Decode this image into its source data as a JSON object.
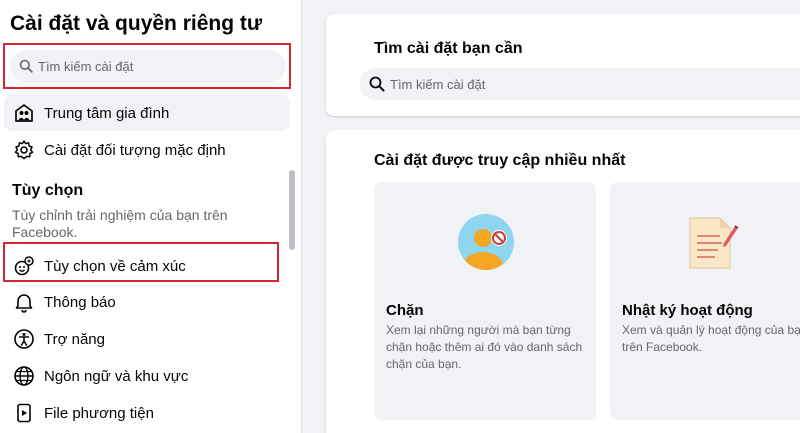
{
  "sidebar": {
    "title": "Cài đặt và quyền riêng tư",
    "search_placeholder": "Tìm kiếm cài đặt",
    "items_top": [
      {
        "label": "Trung tâm gia đình",
        "icon": "family-center-icon"
      },
      {
        "label": "Cài đặt đối tượng mặc định",
        "icon": "gear-icon"
      }
    ],
    "section": {
      "title": "Tùy chọn",
      "description": "Tùy chỉnh trải nghiệm của bạn trên Facebook."
    },
    "items_bottom": [
      {
        "label": "Tùy chọn về cảm xúc",
        "icon": "reactions-icon"
      },
      {
        "label": "Thông báo",
        "icon": "bell-icon"
      },
      {
        "label": "Trợ năng",
        "icon": "accessibility-icon"
      },
      {
        "label": "Ngôn ngữ và khu vực",
        "icon": "globe-icon"
      },
      {
        "label": "File phương tiện",
        "icon": "media-icon"
      }
    ]
  },
  "main": {
    "search_card": {
      "title": "Tìm cài đặt bạn cần",
      "search_placeholder": "Tìm kiếm cài đặt"
    },
    "most_visited": {
      "title": "Cài đặt được truy cập nhiều nhất",
      "tiles": [
        {
          "title": "Chặn",
          "description": "Xem lại những người mà bạn từng chặn hoặc thêm ai đó vào danh sách chặn của bạn.",
          "icon": "block-user-icon"
        },
        {
          "title": "Nhật ký hoạt động",
          "description": "Xem và quản lý hoạt động của bạn trên Facebook.",
          "icon": "activity-log-icon"
        }
      ]
    }
  },
  "colors": {
    "highlight": "#d9262e",
    "page_bg": "#f0f2f5",
    "secondary_text": "#65676b"
  }
}
